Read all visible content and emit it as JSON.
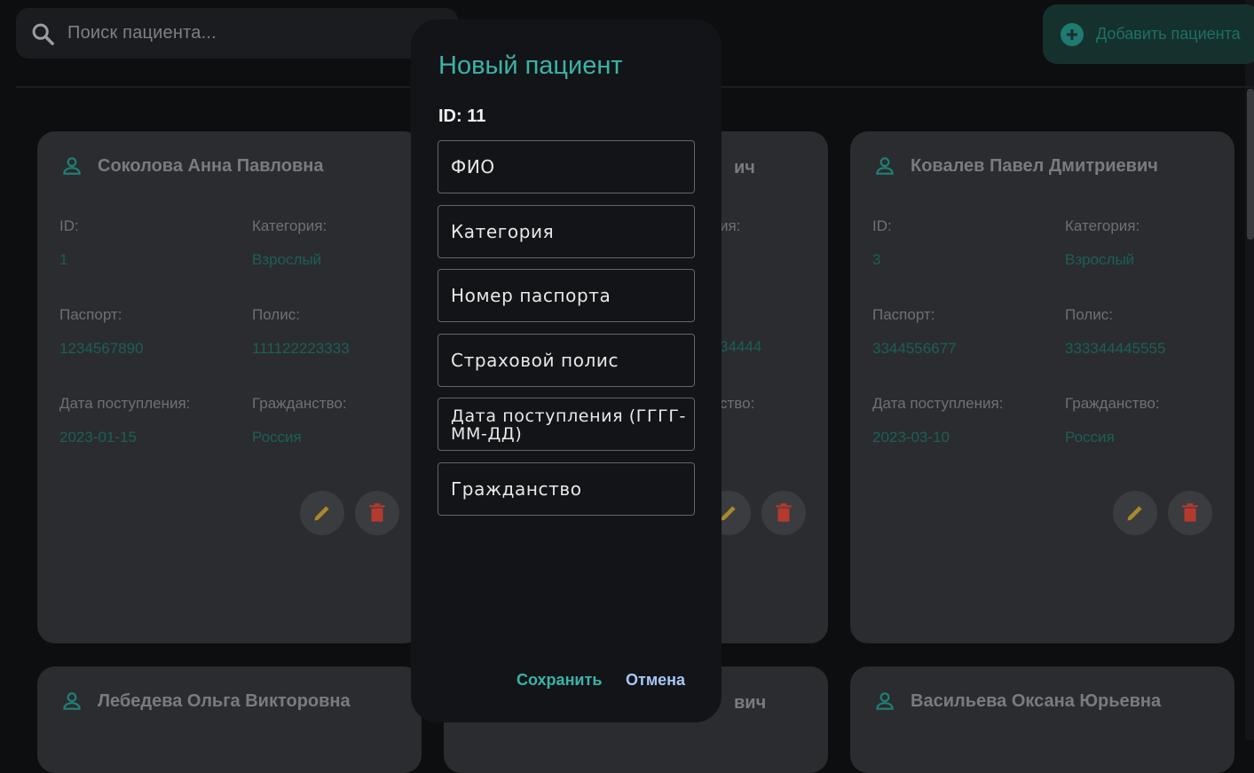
{
  "search": {
    "placeholder": "Поиск пациента..."
  },
  "toolbar": {
    "add_label": "Добавить пациента"
  },
  "field_labels": {
    "id": "ID:",
    "category": "Категория:",
    "passport": "Паспорт:",
    "policy": "Полис:",
    "admission": "Дата поступления:",
    "citizenship": "Гражданство:"
  },
  "cards": [
    {
      "name": "Соколова Анна Павловна",
      "id": "1",
      "category": "Взрослый",
      "passport": "1234567890",
      "policy": "111122223333",
      "admission": "2023-01-15",
      "citizenship": "Россия"
    },
    {
      "name_partial": "ич",
      "category_partial": "ия:",
      "policy_partial": "34444",
      "citizenship_partial": "ство:"
    },
    {
      "name": "Ковалев Павел Дмитриевич",
      "id": "3",
      "category": "Взрослый",
      "passport": "3344556677",
      "policy": "333344445555",
      "admission": "2023-03-10",
      "citizenship": "Россия"
    },
    {
      "name": "Лебедева Ольга Викторовна"
    },
    {
      "name_partial": "вич"
    },
    {
      "name": "Васильева Оксана Юрьевна"
    }
  ],
  "modal": {
    "title": "Новый пациент",
    "id_text": "ID: 11",
    "fields": [
      "ФИО",
      "Категория",
      "Номер паспорта",
      "Страховой полис",
      "Дата поступления (ГГГГ-ММ-ДД)",
      "Гражданство"
    ],
    "save_label": "Сохранить",
    "cancel_label": "Отмена"
  },
  "colors": {
    "accent": "#3bb3a6",
    "delete": "#b43a2e",
    "edit": "#a8892a",
    "link": "#a7c7f3"
  },
  "icons": [
    "search-icon",
    "add-circle-icon",
    "person-icon",
    "edit-icon",
    "delete-icon"
  ]
}
